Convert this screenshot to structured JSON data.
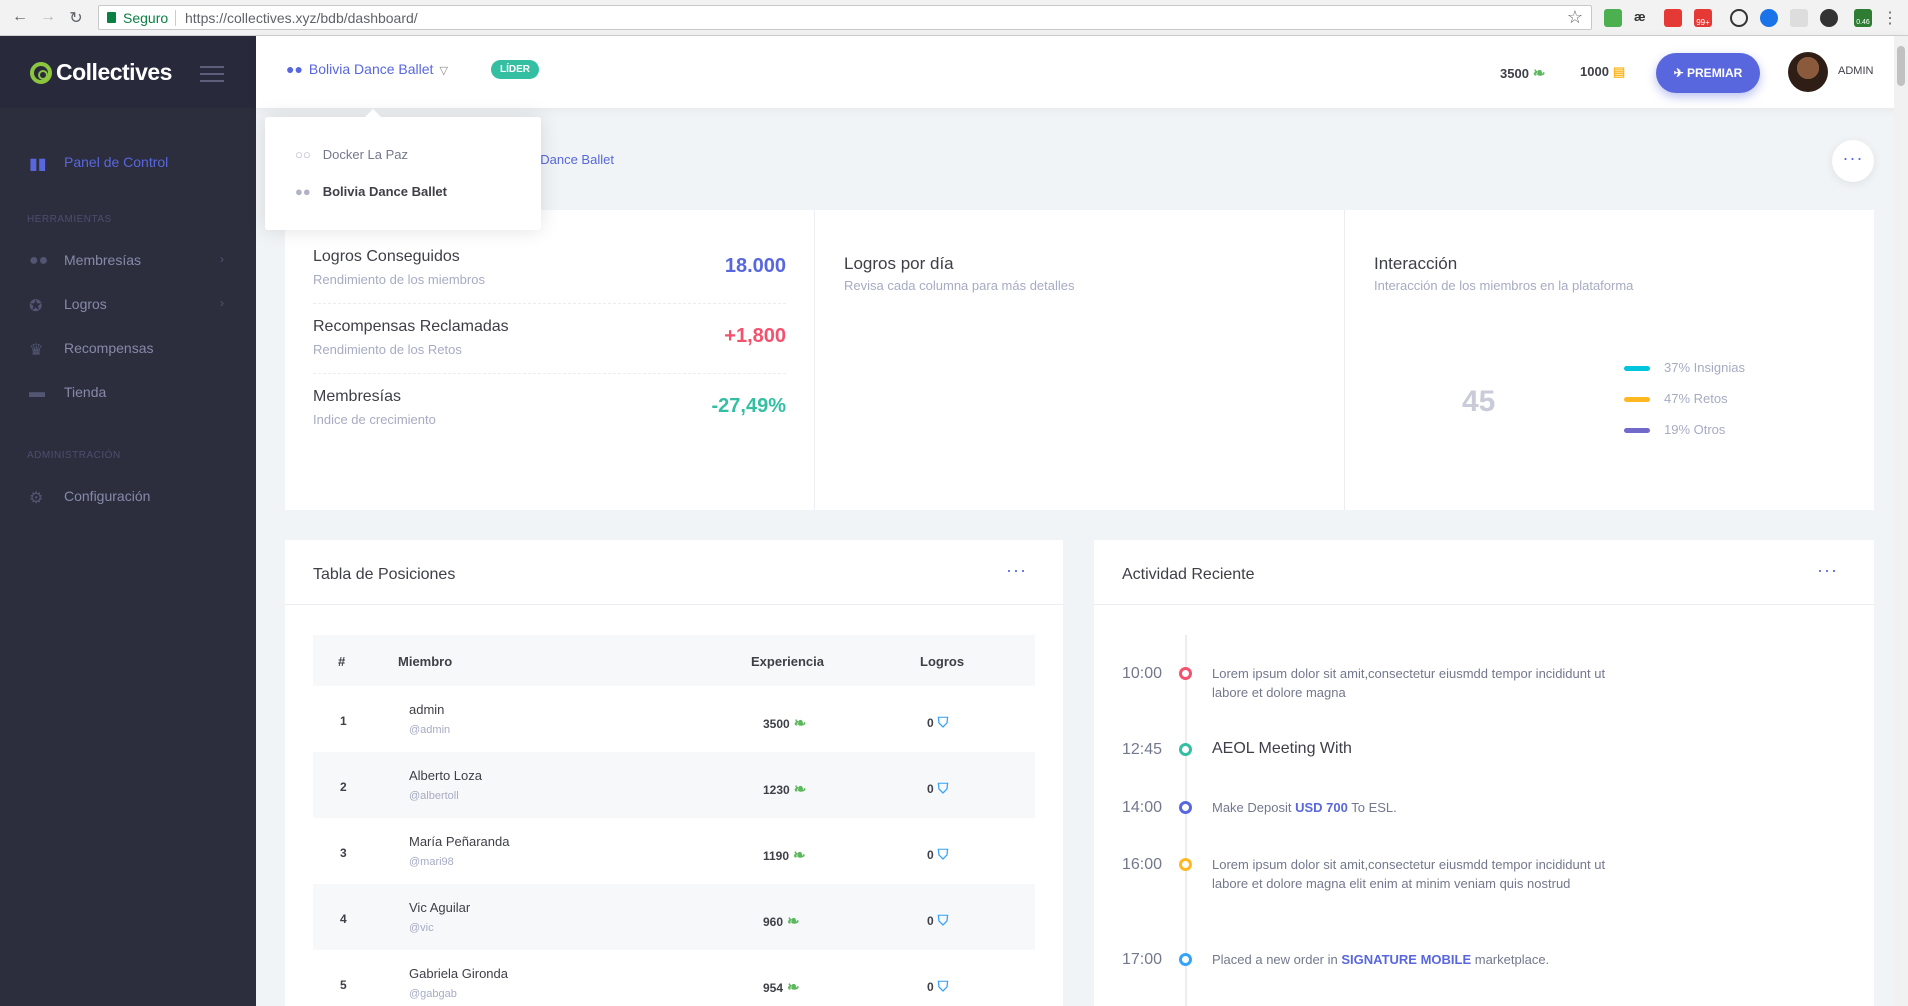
{
  "browser": {
    "secure_label": "Seguro",
    "url": "https://collectives.xyz/bdb/dashboard/",
    "extension_badges": [
      "99+",
      "0.46"
    ]
  },
  "app": {
    "brand": "Collectives",
    "colors": {
      "accent": "#5867dd",
      "success": "#34bfa3",
      "danger": "#f4516c",
      "sidebar": "#2c2e3e",
      "brand_green": "#8cc63f"
    }
  },
  "sidebar": {
    "items": [
      {
        "label": "Panel de Control",
        "icon": "bar-chart-icon",
        "active": true
      }
    ],
    "sections": [
      {
        "title": "HERRAMIENTAS",
        "items": [
          {
            "label": "Membresías",
            "icon": "users-icon",
            "has_children": true
          },
          {
            "label": "Logros",
            "icon": "medal-icon",
            "has_children": true
          },
          {
            "label": "Recompensas",
            "icon": "trophy-icon",
            "has_children": false
          },
          {
            "label": "Tienda",
            "icon": "store-icon",
            "has_children": false
          }
        ]
      },
      {
        "title": "ADMINISTRACIÓN",
        "items": [
          {
            "label": "Configuración",
            "icon": "gears-icon",
            "has_children": false
          }
        ]
      }
    ]
  },
  "topbar": {
    "group": "Bolivia Dance Ballet",
    "role_badge": "LÍDER",
    "points": "3500",
    "coins": "1000",
    "premiar": "PREMIAR",
    "user": "ADMIN"
  },
  "group_dropdown": {
    "items": [
      {
        "label": "Docker La Paz",
        "selected": false
      },
      {
        "label": "Bolivia Dance Ballet",
        "selected": true
      }
    ]
  },
  "breadcrumb": "via Dance Ballet",
  "stats": {
    "rows": [
      {
        "title": "Logros Conseguidos",
        "subtitle": "Rendimiento de los miembros",
        "value": "18.000",
        "color": "#5867dd"
      },
      {
        "title": "Recompensas Reclamadas",
        "subtitle": "Rendimiento de los Retos",
        "value": "+1,800",
        "color": "#f4516c"
      },
      {
        "title": "Membresías",
        "subtitle": "Indice de crecimiento",
        "value": "-27,49%",
        "color": "#34bfa3"
      }
    ],
    "logros_por_dia": {
      "title": "Logros por día",
      "subtitle": "Revisa cada columna para más detalles"
    },
    "interaccion": {
      "title": "Interacción",
      "subtitle": "Interacción de los miembros en la plataforma",
      "center_value": "45",
      "legend": [
        {
          "label": "37% Insignias",
          "color": "#00c5dc"
        },
        {
          "label": "47% Retos",
          "color": "#ffb822"
        },
        {
          "label": "19% Otros",
          "color": "#716aca"
        }
      ]
    }
  },
  "leaderboard": {
    "title": "Tabla de Posiciones",
    "columns": [
      "#",
      "Miembro",
      "Experiencia",
      "Logros"
    ],
    "rows": [
      {
        "rank": "1",
        "name": "admin",
        "handle": "@admin",
        "xp": "3500",
        "logros": "0"
      },
      {
        "rank": "2",
        "name": "Alberto Loza",
        "handle": "@albertoll",
        "xp": "1230",
        "logros": "0"
      },
      {
        "rank": "3",
        "name": "María Peñaranda",
        "handle": "@mari98",
        "xp": "1190",
        "logros": "0"
      },
      {
        "rank": "4",
        "name": "Vic Aguilar",
        "handle": "@vic",
        "xp": "960",
        "logros": "0"
      },
      {
        "rank": "5",
        "name": "Gabriela Gironda",
        "handle": "@gabgab",
        "xp": "954",
        "logros": "0"
      }
    ]
  },
  "activity": {
    "title": "Actividad Reciente",
    "items": [
      {
        "time": "10:00",
        "color": "#f4516c",
        "text": "Lorem ipsum dolor sit amit,consectetur eiusmdd tempor incididunt ut labore et dolore magna"
      },
      {
        "time": "12:45",
        "color": "#34bfa3",
        "text": "AEOL Meeting With",
        "large": true
      },
      {
        "time": "14:00",
        "color": "#5867dd",
        "pre": "Make Deposit ",
        "highlight": "USD 700",
        "post": " To ESL."
      },
      {
        "time": "16:00",
        "color": "#ffb822",
        "text": "Lorem ipsum dolor sit amit,consectetur eiusmdd tempor incididunt ut labore et dolore magna elit enim at minim veniam quis nostrud"
      },
      {
        "time": "17:00",
        "color": "#36a3f7",
        "pre": "Placed a new order in ",
        "highlight": "SIGNATURE MOBILE",
        "post": " marketplace."
      }
    ]
  }
}
